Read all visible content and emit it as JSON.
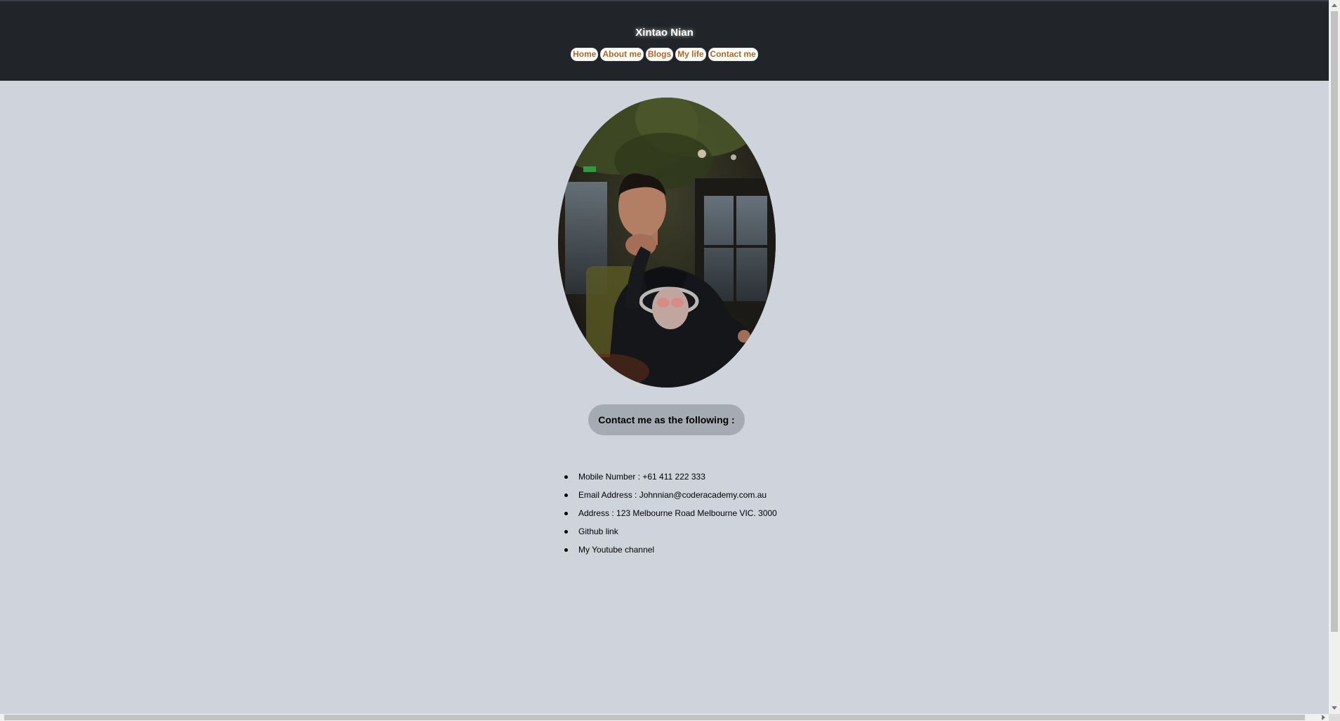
{
  "header": {
    "site_title": "Xintao Nian",
    "nav": [
      {
        "label": "Home"
      },
      {
        "label": "About me"
      },
      {
        "label": "Blogs"
      },
      {
        "label": "My life"
      },
      {
        "label": "Contact me"
      }
    ]
  },
  "main": {
    "heading": "Contact me as the following :",
    "contact_items": [
      {
        "text": "Mobile Number : +61 411 222 333"
      },
      {
        "text": "Email Address : Johnnian@coderacademy.com.au"
      },
      {
        "text": "Address : 123 Melbourne Road Melbourne VIC. 3000"
      },
      {
        "text": "Github link"
      },
      {
        "text": "My Youtube channel"
      }
    ]
  },
  "colors": {
    "header_bg": "#212429",
    "page_bg": "#cfd4dc",
    "nav_text": "#b5651d",
    "pill_bg": "#a4abb3"
  }
}
